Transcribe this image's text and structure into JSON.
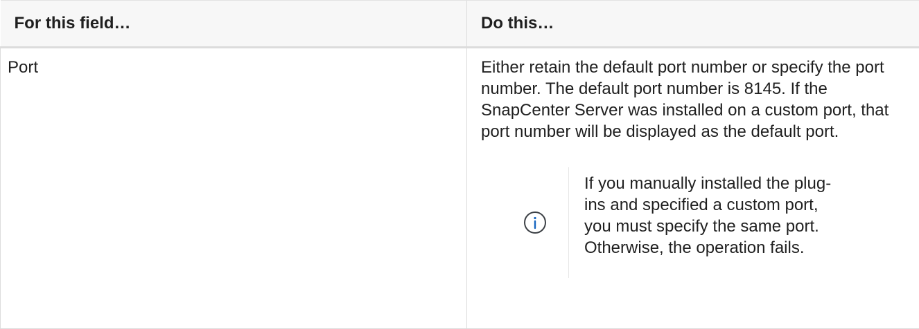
{
  "table": {
    "headers": {
      "field": "For this field…",
      "action": "Do this…"
    },
    "rows": [
      {
        "field": "Port",
        "description": "Either retain the default port number or specify the port number. The default port number is 8145. If the SnapCenter Server was installed on a custom port, that port number will be displayed as the default port.",
        "note": {
          "icon": "info-icon",
          "text": "If you manually installed the plug-ins and specified a custom port, you must specify the same port. Otherwise, the operation fails."
        }
      }
    ]
  },
  "colors": {
    "info_icon": "#3c4045",
    "border": "#dcdcdc",
    "header_bg": "#f7f7f7"
  }
}
